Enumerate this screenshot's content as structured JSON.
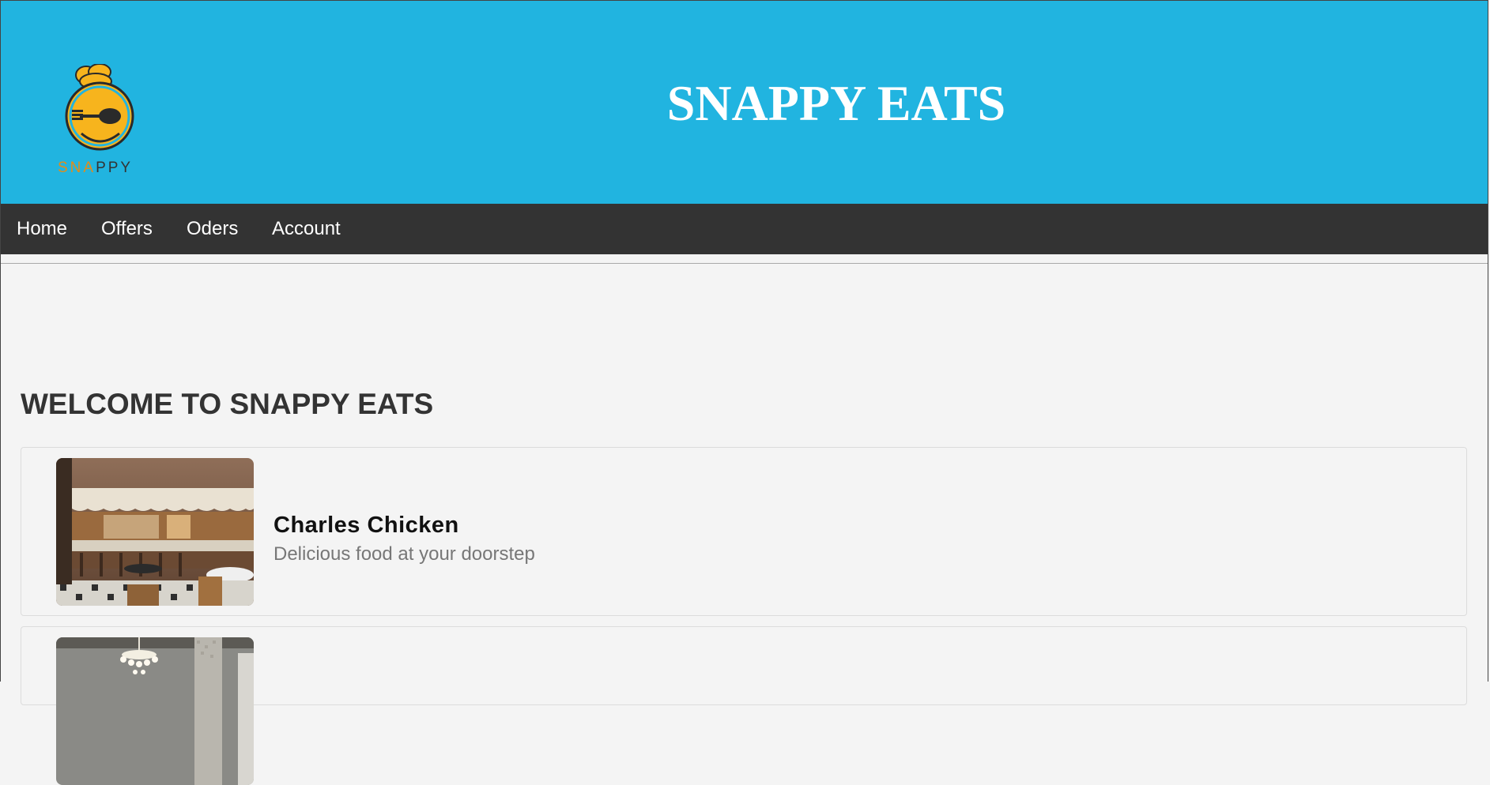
{
  "header": {
    "logo_text_orange": "SNA",
    "logo_text_dark": "PPY",
    "title": "SNAPPY EATS"
  },
  "nav": {
    "items": [
      {
        "label": "Home"
      },
      {
        "label": "Offers"
      },
      {
        "label": "Oders"
      },
      {
        "label": "Account"
      }
    ]
  },
  "main": {
    "heading": "WELCOME TO SNAPPY EATS",
    "restaurants": [
      {
        "name": "Charles Chicken",
        "description": "Delicious food at your doorstep"
      },
      {
        "name": "",
        "description": ""
      }
    ]
  },
  "colors": {
    "banner": "#21b4e0",
    "nav": "#333333",
    "page_bg": "#f4f4f4",
    "logo_orange": "#e28c19"
  }
}
